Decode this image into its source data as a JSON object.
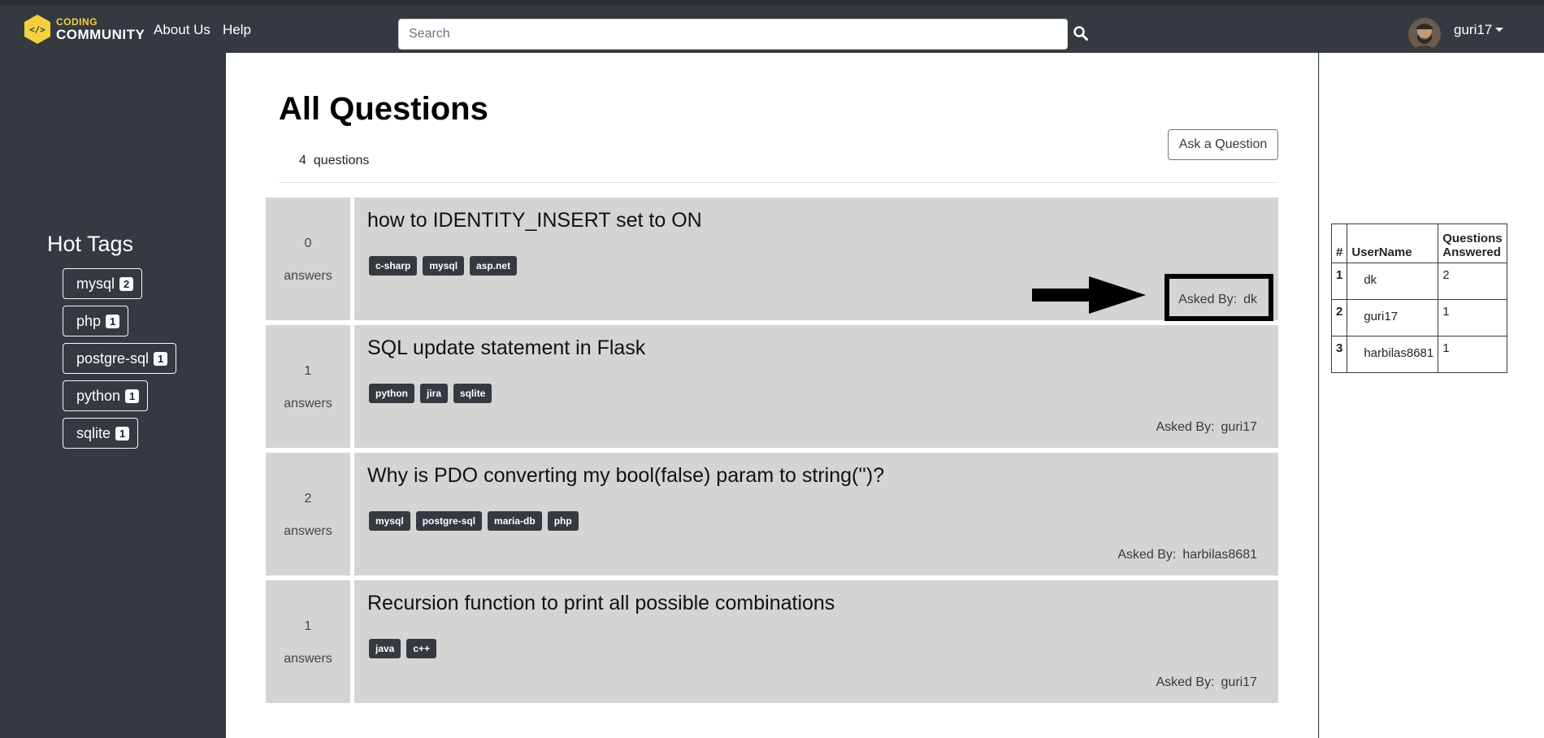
{
  "brand": {
    "line1": "CODING",
    "line2": "COMMUNITY",
    "accent": "#f4d03f"
  },
  "nav": {
    "about": "About Us",
    "help": "Help"
  },
  "search": {
    "placeholder": "Search"
  },
  "user": {
    "name": "guri17"
  },
  "sidebar": {
    "title": "Hot Tags",
    "tags": [
      {
        "name": "mysql",
        "count": "2"
      },
      {
        "name": "php",
        "count": "1"
      },
      {
        "name": "postgre-sql",
        "count": "1"
      },
      {
        "name": "python",
        "count": "1"
      },
      {
        "name": "sqlite",
        "count": "1"
      }
    ]
  },
  "main": {
    "title": "All Questions",
    "count": "4",
    "count_label": "questions",
    "ask_button": "Ask a Question",
    "asked_by_label": "Asked By:",
    "questions": [
      {
        "answers": "0",
        "answers_label": "answers",
        "title": "how to IDENTITY_INSERT set to ON",
        "tags": [
          "c-sharp",
          "mysql",
          "asp.net"
        ],
        "author": "dk"
      },
      {
        "answers": "1",
        "answers_label": "answers",
        "title": "SQL update statement in Flask",
        "tags": [
          "python",
          "jira",
          "sqlite"
        ],
        "author": "guri17"
      },
      {
        "answers": "2",
        "answers_label": "answers",
        "title": "Why is PDO converting my bool(false) param to string('')?",
        "tags": [
          "mysql",
          "postgre-sql",
          "maria-db",
          "php"
        ],
        "author": "harbilas8681"
      },
      {
        "answers": "1",
        "answers_label": "answers",
        "title": "Recursion function to print all possible combinations",
        "tags": [
          "java",
          "c++"
        ],
        "author": "guri17"
      }
    ]
  },
  "ranking": {
    "headers": {
      "rank": "#",
      "user": "UserName",
      "answered": "Questions Answered"
    },
    "rows": [
      {
        "rank": "1",
        "user": "dk",
        "answered": "2"
      },
      {
        "rank": "2",
        "user": "guri17",
        "answered": "1"
      },
      {
        "rank": "3",
        "user": "harbilas8681",
        "answered": "1"
      }
    ]
  }
}
